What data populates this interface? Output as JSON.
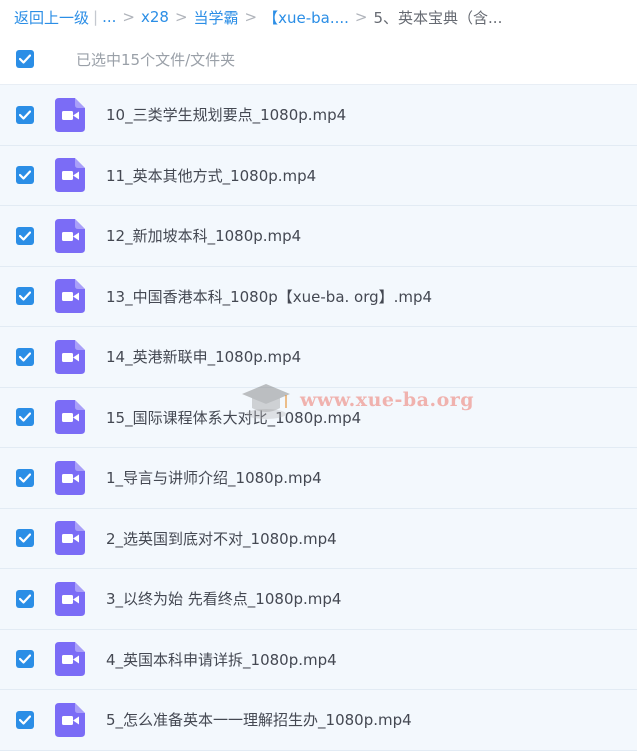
{
  "breadcrumb": {
    "back": "返回上一级",
    "divider": "|",
    "ellipsis": "...",
    "crumbs": [
      "x28",
      "当学霸",
      "【xue-ba...."
    ],
    "current": "5、英本宝典（含..."
  },
  "selection": {
    "label": "已选中15个文件/文件夹",
    "all_checked": true
  },
  "files": [
    {
      "name": "10_三类学生规划要点_1080p.mp4",
      "checked": true,
      "icon": "video-file-icon"
    },
    {
      "name": "11_英本其他方式_1080p.mp4",
      "checked": true,
      "icon": "video-file-icon"
    },
    {
      "name": "12_新加坡本科_1080p.mp4",
      "checked": true,
      "icon": "video-file-icon"
    },
    {
      "name": "13_中国香港本科_1080p【xue-ba. org】.mp4",
      "checked": true,
      "icon": "video-file-icon"
    },
    {
      "name": "14_英港新联申_1080p.mp4",
      "checked": true,
      "icon": "video-file-icon"
    },
    {
      "name": "15_国际课程体系大对比_1080p.mp4",
      "checked": true,
      "icon": "video-file-icon"
    },
    {
      "name": "1_导言与讲师介绍_1080p.mp4",
      "checked": true,
      "icon": "video-file-icon"
    },
    {
      "name": "2_选英国到底对不对_1080p.mp4",
      "checked": true,
      "icon": "video-file-icon"
    },
    {
      "name": "3_以终为始 先看终点_1080p.mp4",
      "checked": true,
      "icon": "video-file-icon"
    },
    {
      "name": "4_英国本科申请详拆_1080p.mp4",
      "checked": true,
      "icon": "video-file-icon"
    },
    {
      "name": "5_怎么准备英本一一理解招生办_1080p.mp4",
      "checked": true,
      "icon": "video-file-icon"
    }
  ],
  "watermark": {
    "text": "www.xue-ba.org"
  },
  "colors": {
    "accent": "#2b8ee6",
    "video_icon": "#7b6cf6",
    "row_bg": "#f3f8fd"
  }
}
